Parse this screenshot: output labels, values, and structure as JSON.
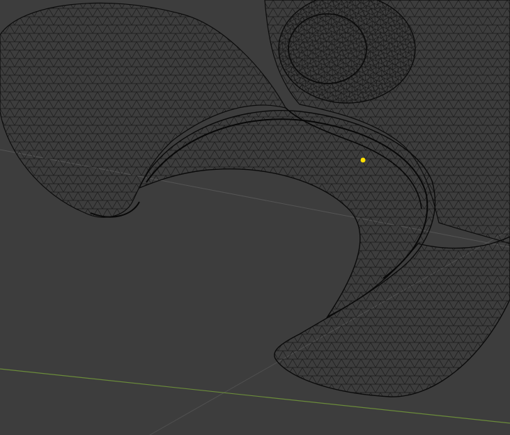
{
  "viewport": {
    "background": "#3d3d3d",
    "mode": "wireframe",
    "grid_floor_color": "#4a4a4a",
    "axis_x_color": "#6b8c3a",
    "axis_y_color": "#5a5a5a"
  },
  "mesh": {
    "shading": "wireframe",
    "edge_color": "#111111",
    "fill_color": "#3f3f3f"
  },
  "selection": {
    "vertex_color": "#ffe000",
    "selected_count": 1
  },
  "icons": {
    "origin": "origin-dot-icon"
  }
}
